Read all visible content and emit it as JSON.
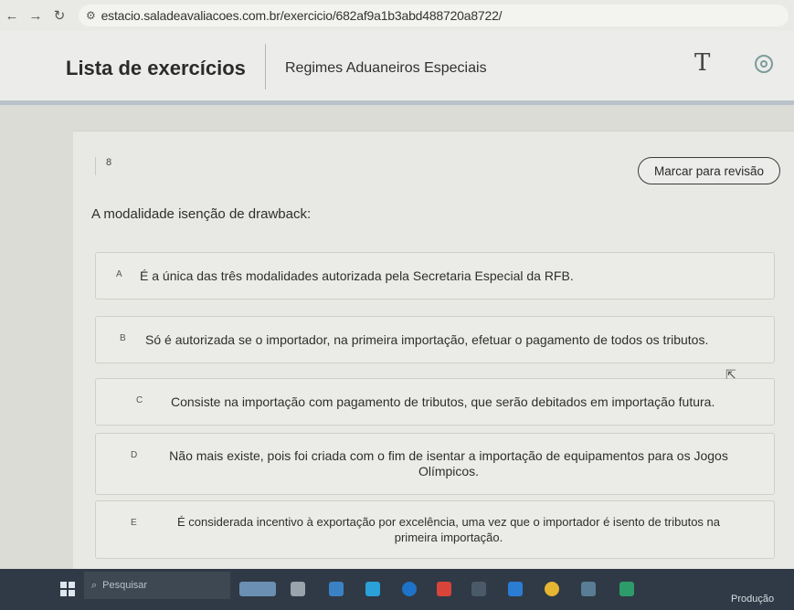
{
  "browser": {
    "back_icon": "arrow-left-icon",
    "forward_icon": "arrow-right-icon",
    "reload_icon": "reload-icon",
    "url": "estacio.saladeavaliacoes.com.br/exercicio/682af9a1b3abd488720a8722/"
  },
  "header": {
    "title": "Lista de exercícios",
    "subject": "Regimes Aduaneiros Especiais",
    "font_icon_glyph": "T"
  },
  "question": {
    "number": "8",
    "review_label": "Marcar para revisão",
    "statement": "A modalidade isenção de drawback:",
    "alternatives": [
      {
        "letter": "A",
        "text": "É a única das três modalidades autorizada pela Secretaria Especial da RFB."
      },
      {
        "letter": "B",
        "text": "Só é autorizada se o importador, na primeira importação, efetuar o pagamento de todos os tributos."
      },
      {
        "letter": "C",
        "text": "Consiste na importação com pagamento de tributos, que serão debitados em importação futura."
      },
      {
        "letter": "D",
        "text": "Não mais existe, pois foi criada com o fim de isentar a importação de equipamentos para os Jogos Olímpicos."
      },
      {
        "letter": "E",
        "text": "É considerada incentivo à exportação por excelência, uma vez que o importador é isento de tributos na primeira importação."
      }
    ]
  },
  "taskbar": {
    "search_placeholder": "Pesquisar",
    "status_text": "Produção"
  },
  "colors": {
    "page_bg": "#dcdcd7",
    "header_rule": "#b9c2c8",
    "taskbar": "#2f3a46"
  }
}
